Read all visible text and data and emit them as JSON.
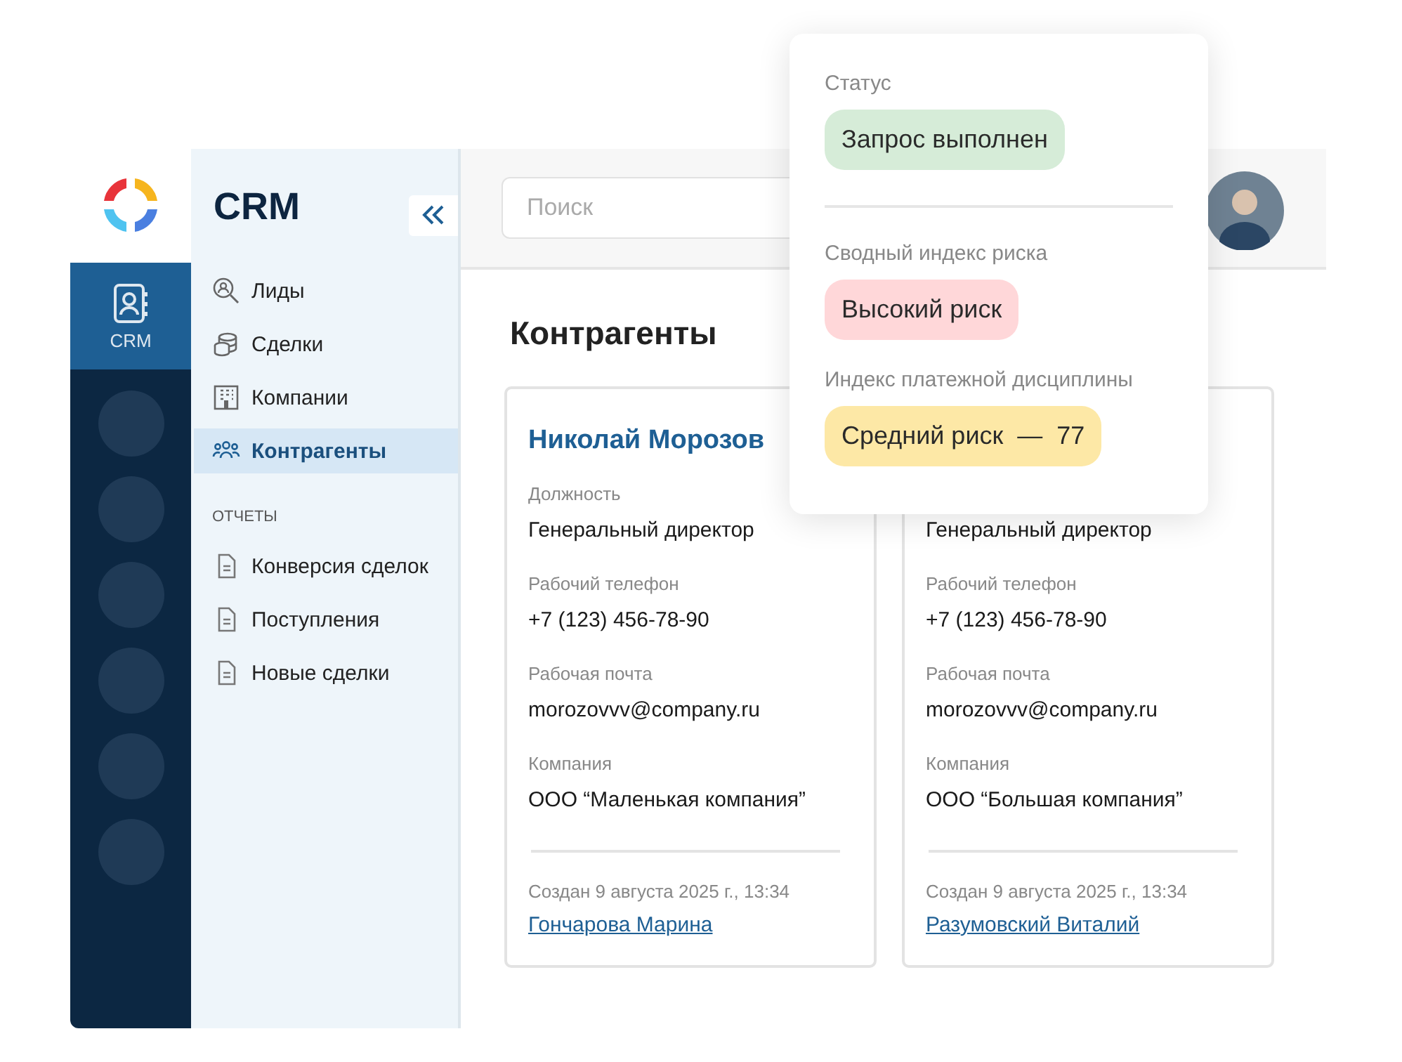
{
  "rail": {
    "items": [
      {
        "label": "CRM",
        "selected": true
      }
    ]
  },
  "sidebar": {
    "title": "CRM",
    "items": [
      {
        "label": "Лиды",
        "selected": false
      },
      {
        "label": "Сделки",
        "selected": false
      },
      {
        "label": "Компании",
        "selected": false
      },
      {
        "label": "Контрагенты",
        "selected": true
      }
    ],
    "reports_heading": "ОТЧЕТЫ",
    "reports": [
      {
        "label": "Конверсия сделок"
      },
      {
        "label": "Поступления"
      },
      {
        "label": "Новые сделки"
      }
    ]
  },
  "header": {
    "search": {
      "placeholder": "Поиск"
    }
  },
  "page_title": "Контрагенты",
  "cards": [
    {
      "name": "Николай Морозов",
      "fields": [
        {
          "label": "Должность",
          "value": "Генеральный директор"
        },
        {
          "label": "Рабочий телефон",
          "value": "+7 (123) 456-78-90"
        },
        {
          "label": "Рабочая почта",
          "value": "morozovvv@company.ru"
        },
        {
          "label": "Компания",
          "value": "ООО “Маленькая компания”"
        }
      ],
      "created": "Создан 9 августа 2025 г., 13:34",
      "author": "Гончарова Марина"
    },
    {
      "fields": [
        {
          "value": "Генеральный директор"
        },
        {
          "label": "Рабочий телефон",
          "value": "+7 (123) 456-78-90"
        },
        {
          "label": "Рабочая почта",
          "value": "morozovvv@company.ru"
        },
        {
          "label": "Компания",
          "value": "ООО “Большая компания”"
        }
      ],
      "created": "Создан 9 августа 2025 г., 13:34",
      "author": "Разумовский Виталий"
    }
  ],
  "popup": {
    "sections": [
      {
        "label": "Статус",
        "value": "Запрос выполнен",
        "color": "#d6ecd8"
      },
      {
        "label": "Сводный индекс риска",
        "value": "Высокий риск",
        "color": "#ffd7d9"
      },
      {
        "label": "Индекс платежной дисциплины",
        "value": "Средний риск  —  77",
        "color": "#fde8a6"
      }
    ]
  }
}
